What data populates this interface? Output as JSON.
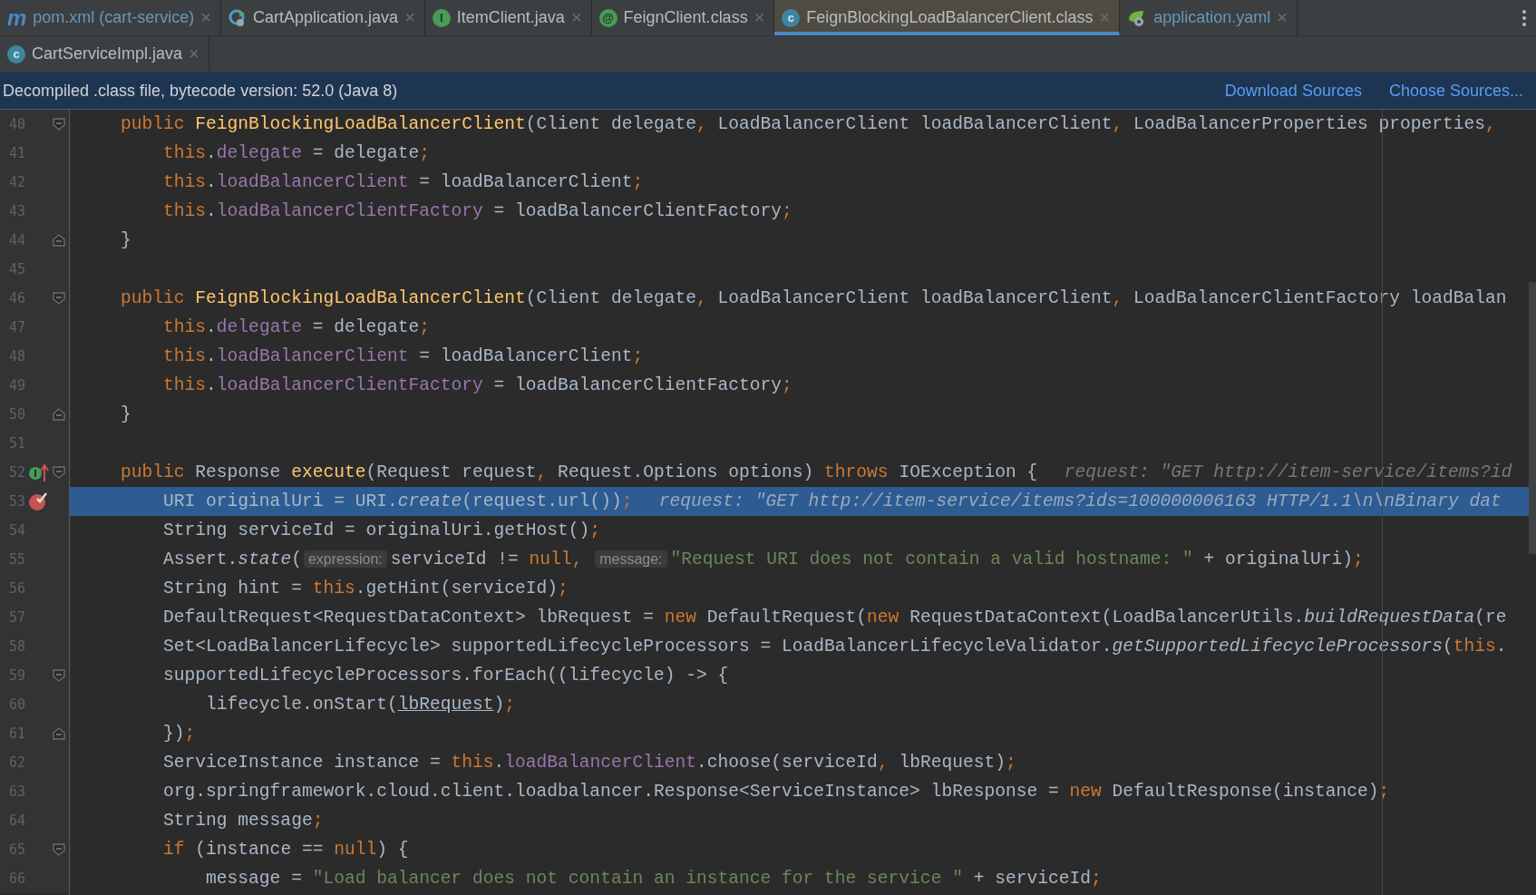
{
  "tabs": [
    {
      "label": "pom.xml (cart-service)",
      "icon": {
        "kind": "maven",
        "glyph": "m"
      },
      "color": "#6897bb",
      "selected": false,
      "close": "×"
    },
    {
      "label": "CartApplication.java",
      "icon": {
        "kind": "spring-app"
      },
      "color": "#bbbbbb",
      "selected": false,
      "close": "×"
    },
    {
      "label": "ItemClient.java",
      "icon": {
        "kind": "interface",
        "glyph": "I"
      },
      "color": "#bbbbbb",
      "selected": false,
      "close": "×"
    },
    {
      "label": "FeignClient.class",
      "icon": {
        "kind": "annotation",
        "glyph": "@"
      },
      "color": "#bbbbbb",
      "selected": false,
      "close": "×"
    },
    {
      "label": "FeignBlockingLoadBalancerClient.class",
      "icon": {
        "kind": "class",
        "glyph": "c"
      },
      "color": "#bbbbbb",
      "selected": true,
      "close": "×"
    },
    {
      "label": "application.yaml",
      "icon": {
        "kind": "spring-config"
      },
      "color": "#6897bb",
      "selected": false,
      "close": "×"
    }
  ],
  "tabs_row_2": [
    {
      "label": "CartServiceImpl.java",
      "icon": {
        "kind": "class",
        "glyph": "c"
      },
      "color": "#bbbbbb",
      "selected": false,
      "close": "×"
    }
  ],
  "banner": {
    "text": "Decompiled .class file, bytecode version: 52.0 (Java 8)",
    "links": [
      "Download Sources",
      "Choose Sources..."
    ]
  },
  "code": [
    {
      "number": "40",
      "fold": {
        "kind": "start"
      },
      "selected": false,
      "tokens": [
        {
          "kind": "keyword",
          "text": "public "
        },
        {
          "kind": "function",
          "text": "FeignBlockingLoadBalancerClient"
        },
        {
          "kind": "plain",
          "text": "(Client delegate, LoadBalancerClient loadBalancerClient, LoadBalancerProperties properties,"
        }
      ]
    },
    {
      "number": "41",
      "selected": false,
      "tokens": [
        {
          "kind": "keyword",
          "text": "    this"
        },
        {
          "kind": "member",
          "text": ".delegate"
        },
        {
          "kind": "plain",
          "text": " = delegate;"
        }
      ]
    },
    {
      "number": "42",
      "selected": false,
      "tokens": [
        {
          "kind": "keyword",
          "text": "    this"
        },
        {
          "kind": "member",
          "text": ".loadBalancerClient"
        },
        {
          "kind": "plain",
          "text": " = loadBalancerClient;"
        }
      ]
    },
    {
      "number": "43",
      "selected": false,
      "tokens": [
        {
          "kind": "keyword",
          "text": "    this"
        },
        {
          "kind": "member",
          "text": ".loadBalancerClientFactory"
        },
        {
          "kind": "plain",
          "text": " = loadBalancerClientFactory;"
        }
      ]
    },
    {
      "number": "44",
      "fold": {
        "kind": "end"
      },
      "selected": false,
      "tokens": [
        {
          "kind": "plain",
          "text": "}"
        }
      ]
    },
    {
      "number": "45",
      "selected": false
    },
    {
      "number": "46",
      "fold": {
        "kind": "start"
      },
      "selected": false,
      "tokens": [
        {
          "kind": "keyword",
          "text": "public "
        },
        {
          "kind": "function",
          "text": "FeignBlockingLoadBalancerClient"
        },
        {
          "kind": "plain",
          "text": "(Client delegate, LoadBalancerClient loadBalancerClient, LoadBalancerClientFactory loadBalan"
        }
      ]
    },
    {
      "number": "47",
      "selected": false,
      "tokens": [
        {
          "kind": "keyword",
          "text": "    this"
        },
        {
          "kind": "member",
          "text": ".delegate"
        },
        {
          "kind": "plain",
          "text": " = delegate;"
        }
      ]
    },
    {
      "number": "48",
      "selected": false,
      "tokens": [
        {
          "kind": "keyword",
          "text": "    this"
        },
        {
          "kind": "member",
          "text": ".loadBalancerClient"
        },
        {
          "kind": "plain",
          "text": " = loadBalancerClient;"
        }
      ]
    },
    {
      "number": "49",
      "selected": false,
      "tokens": [
        {
          "kind": "keyword",
          "text": "    this"
        },
        {
          "kind": "member",
          "text": ".loadBalancerClientFactory"
        },
        {
          "kind": "plain",
          "text": " = loadBalancerClientFactory;"
        }
      ]
    },
    {
      "number": "50",
      "fold": {
        "kind": "end"
      },
      "selected": false,
      "tokens": [
        {
          "kind": "plain",
          "text": "}"
        }
      ]
    },
    {
      "number": "51",
      "selected": false
    },
    {
      "number": "52",
      "fold": {
        "kind": "start"
      },
      "marker": {
        "kind": "implements"
      },
      "selected": false,
      "tokens": [
        {
          "kind": "keyword",
          "text": "public "
        },
        {
          "kind": "plain",
          "text": "Response "
        },
        {
          "kind": "function",
          "text": "execute"
        },
        {
          "kind": "plain",
          "text": "(Request request, Request.Options options) "
        },
        {
          "kind": "keyword",
          "text": "throws "
        },
        {
          "kind": "plain",
          "text": "IOException {"
        },
        {
          "kind": "hint",
          "text": "request: \"GET http://item-service/items?id"
        }
      ]
    },
    {
      "number": "53",
      "marker": {
        "kind": "breakpoint"
      },
      "selected": true,
      "tokens": [
        {
          "kind": "plain",
          "text": "    URI originalUri = URI."
        },
        {
          "kind": "static",
          "text": "create"
        },
        {
          "kind": "plain",
          "text": "(request.url());"
        },
        {
          "kind": "hint",
          "text": "request: \"GET http://item-service/items?ids=100000006163 HTTP/1.1\\n\\nBinary dat"
        }
      ]
    },
    {
      "number": "54",
      "selected": false,
      "tokens": [
        {
          "kind": "plain",
          "text": "    String serviceId = originalUri.getHost();"
        }
      ]
    },
    {
      "number": "55",
      "selected": false,
      "tokens": [
        {
          "kind": "plain",
          "text": "    Assert."
        },
        {
          "kind": "static",
          "text": "state"
        },
        {
          "kind": "plain",
          "text": "("
        },
        {
          "kind": "inlay",
          "text": "expression:"
        },
        {
          "kind": "plain",
          "text": "serviceId != "
        },
        {
          "kind": "keyword",
          "text": "null"
        },
        {
          "kind": "plain",
          "text": ", "
        },
        {
          "kind": "inlay",
          "text": "message:"
        },
        {
          "kind": "string",
          "text": "\"Request URI does not contain a valid hostname: \""
        },
        {
          "kind": "plain",
          "text": " + originalUri);"
        }
      ]
    },
    {
      "number": "56",
      "selected": false,
      "tokens": [
        {
          "kind": "plain",
          "text": "    String hint = "
        },
        {
          "kind": "keyword",
          "text": "this"
        },
        {
          "kind": "plain",
          "text": ".getHint(serviceId);"
        }
      ]
    },
    {
      "number": "57",
      "selected": false,
      "tokens": [
        {
          "kind": "plain",
          "text": "    DefaultRequest<RequestDataContext> lbRequest = "
        },
        {
          "kind": "keyword",
          "text": "new "
        },
        {
          "kind": "plain",
          "text": "DefaultRequest("
        },
        {
          "kind": "keyword",
          "text": "new "
        },
        {
          "kind": "plain",
          "text": "RequestDataContext(LoadBalancerUtils."
        },
        {
          "kind": "static",
          "text": "buildRequestData"
        },
        {
          "kind": "plain",
          "text": "(re"
        }
      ]
    },
    {
      "number": "58",
      "selected": false,
      "tokens": [
        {
          "kind": "plain",
          "text": "    Set<LoadBalancerLifecycle> supportedLifecycleProcessors = LoadBalancerLifecycleValidator."
        },
        {
          "kind": "static",
          "text": "getSupportedLifecycleProcessors"
        },
        {
          "kind": "plain",
          "text": "("
        },
        {
          "kind": "keyword",
          "text": "this"
        },
        {
          "kind": "plain",
          "text": "."
        }
      ]
    },
    {
      "number": "59",
      "fold": {
        "kind": "start"
      },
      "selected": false,
      "tokens": [
        {
          "kind": "plain",
          "text": "    supportedLifecycleProcessors.forEach((lifecycle) -> {"
        }
      ]
    },
    {
      "number": "60",
      "selected": false,
      "tokens": [
        {
          "kind": "plain",
          "text": "        lifecycle.onStart("
        },
        {
          "kind": "reference",
          "text": "lbRequest"
        },
        {
          "kind": "plain",
          "text": ");"
        }
      ]
    },
    {
      "number": "61",
      "fold": {
        "kind": "end"
      },
      "selected": false,
      "tokens": [
        {
          "kind": "plain",
          "text": "    });"
        }
      ]
    },
    {
      "number": "62",
      "selected": false,
      "tokens": [
        {
          "kind": "plain",
          "text": "    ServiceInstance instance = "
        },
        {
          "kind": "keyword",
          "text": "this"
        },
        {
          "kind": "member",
          "text": ".loadBalancerClient"
        },
        {
          "kind": "plain",
          "text": ".choose(serviceId, lbRequest);"
        }
      ]
    },
    {
      "number": "63",
      "selected": false,
      "tokens": [
        {
          "kind": "plain",
          "text": "    org.springframework.cloud.client.loadbalancer.Response<ServiceInstance> lbResponse = "
        },
        {
          "kind": "keyword",
          "text": "new "
        },
        {
          "kind": "plain",
          "text": "DefaultResponse(instance);"
        }
      ]
    },
    {
      "number": "64",
      "selected": false,
      "tokens": [
        {
          "kind": "plain",
          "text": "    String message;"
        }
      ]
    },
    {
      "number": "65",
      "fold": {
        "kind": "start"
      },
      "selected": false,
      "tokens": [
        {
          "kind": "keyword",
          "text": "    if "
        },
        {
          "kind": "plain",
          "text": "(instance == "
        },
        {
          "kind": "keyword",
          "text": "null"
        },
        {
          "kind": "plain",
          "text": ") {"
        }
      ]
    },
    {
      "number": "66",
      "selected": false,
      "tokens": [
        {
          "kind": "plain",
          "text": "        message = "
        },
        {
          "kind": "string",
          "text": "\"Load balancer does not contain an instance for the service \""
        },
        {
          "kind": "plain",
          "text": " + serviceId;"
        }
      ]
    }
  ]
}
